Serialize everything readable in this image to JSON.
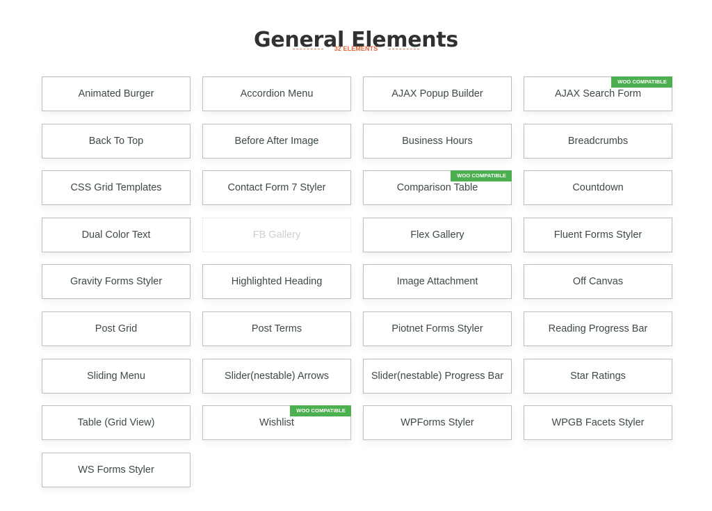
{
  "header": {
    "title": "General Elements",
    "count_label": "32 ELEMENTS"
  },
  "colors": {
    "accent": "#e2683c",
    "badge": "#4caf50",
    "title": "#2f3133"
  },
  "badge_label": "WOO COMPATIBLE",
  "elements": [
    {
      "label": "Animated Burger",
      "woo": false,
      "disabled": false
    },
    {
      "label": "Accordion Menu",
      "woo": false,
      "disabled": false
    },
    {
      "label": "AJAX Popup Builder",
      "woo": false,
      "disabled": false
    },
    {
      "label": "AJAX Search Form",
      "woo": true,
      "disabled": false
    },
    {
      "label": "Back To Top",
      "woo": false,
      "disabled": false
    },
    {
      "label": "Before After Image",
      "woo": false,
      "disabled": false
    },
    {
      "label": "Business Hours",
      "woo": false,
      "disabled": false
    },
    {
      "label": "Breadcrumbs",
      "woo": false,
      "disabled": false
    },
    {
      "label": "CSS Grid Templates",
      "woo": false,
      "disabled": false
    },
    {
      "label": "Contact Form 7 Styler",
      "woo": false,
      "disabled": false
    },
    {
      "label": "Comparison Table",
      "woo": true,
      "disabled": false
    },
    {
      "label": "Countdown",
      "woo": false,
      "disabled": false
    },
    {
      "label": "Dual Color Text",
      "woo": false,
      "disabled": false
    },
    {
      "label": "FB Gallery",
      "woo": false,
      "disabled": true
    },
    {
      "label": "Flex Gallery",
      "woo": false,
      "disabled": false
    },
    {
      "label": "Fluent Forms Styler",
      "woo": false,
      "disabled": false
    },
    {
      "label": "Gravity Forms Styler",
      "woo": false,
      "disabled": false
    },
    {
      "label": "Highlighted Heading",
      "woo": false,
      "disabled": false
    },
    {
      "label": "Image Attachment",
      "woo": false,
      "disabled": false
    },
    {
      "label": "Off Canvas",
      "woo": false,
      "disabled": false
    },
    {
      "label": "Post Grid",
      "woo": false,
      "disabled": false
    },
    {
      "label": "Post Terms",
      "woo": false,
      "disabled": false
    },
    {
      "label": "Piotnet Forms Styler",
      "woo": false,
      "disabled": false
    },
    {
      "label": "Reading Progress Bar",
      "woo": false,
      "disabled": false
    },
    {
      "label": "Sliding Menu",
      "woo": false,
      "disabled": false
    },
    {
      "label": "Slider(nestable) Arrows",
      "woo": false,
      "disabled": false
    },
    {
      "label": "Slider(nestable) Progress Bar",
      "woo": false,
      "disabled": false
    },
    {
      "label": "Star Ratings",
      "woo": false,
      "disabled": false
    },
    {
      "label": "Table (Grid View)",
      "woo": false,
      "disabled": false
    },
    {
      "label": "Wishlist",
      "woo": true,
      "disabled": false
    },
    {
      "label": "WPForms Styler",
      "woo": false,
      "disabled": false
    },
    {
      "label": "WPGB Facets Styler",
      "woo": false,
      "disabled": false
    },
    {
      "label": "WS Forms Styler",
      "woo": false,
      "disabled": false
    }
  ]
}
